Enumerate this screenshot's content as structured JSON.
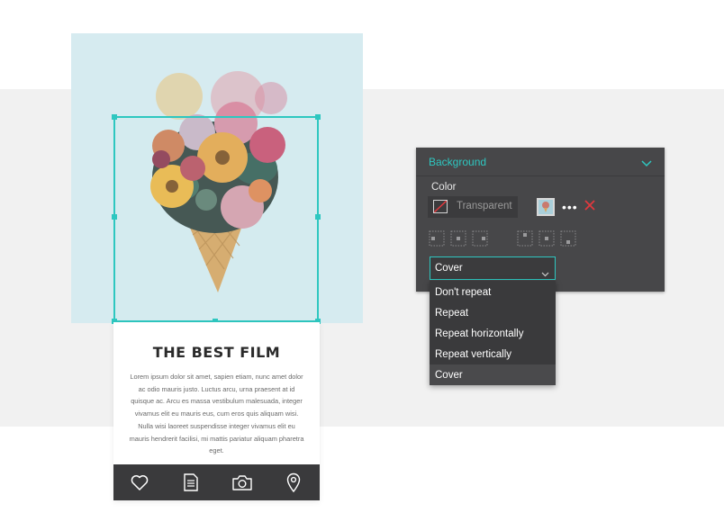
{
  "card": {
    "title": "THE BEST FILM",
    "body": "Lorem ipsum dolor sit amet, sapien etiam, nunc amet dolor ac odio mauris justo. Luctus arcu, urna praesent at id quisque ac. Arcu es massa vestibulum malesuada, integer vivamus elit eu mauris eus, cum eros quis aliquam wisi. Nulla wisi laoreet suspendisse integer vivamus elit eu mauris hendrerit facilisi, mi mattis pariatur aliquam pharetra eget.",
    "tabs": [
      {
        "icon": "heart-icon"
      },
      {
        "icon": "document-icon"
      },
      {
        "icon": "camera-icon"
      },
      {
        "icon": "location-pin-icon"
      }
    ]
  },
  "panel": {
    "title": "Background",
    "color_label": "Color",
    "color_value": "Transparent",
    "more_label": "•••",
    "fit_select": {
      "value": "Cover",
      "options": [
        "Don't repeat",
        "Repeat",
        "Repeat horizontally",
        "Repeat vertically",
        "Cover"
      ],
      "selected": "Cover"
    }
  },
  "colors": {
    "accent": "#2ec7c0",
    "panel_bg": "#474749",
    "dropdown_bg": "#3a3a3c",
    "remove": "#e0393e",
    "tabbar": "#3a3a3c"
  }
}
